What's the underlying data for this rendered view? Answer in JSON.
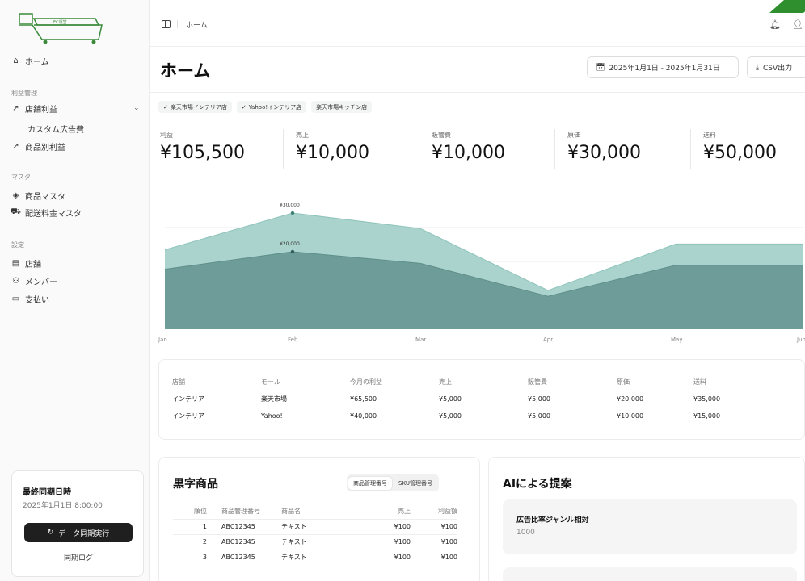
{
  "sidebar": {
    "logo_text": "EC運営",
    "home": "ホーム",
    "section_profit": "利益管理",
    "store_profit": "店舗利益",
    "custom_ad": "カスタム広告費",
    "product_profit": "商品別利益",
    "section_master": "マスタ",
    "product_master": "商品マスタ",
    "shipping_master": "配送料金マスタ",
    "section_settings": "設定",
    "store": "店舗",
    "member": "メンバー",
    "payment": "支払い",
    "sync": {
      "title": "最終同期日時",
      "time": "2025年1月1日 8:00:00",
      "button": "データ同期実行",
      "log": "同期ログ"
    }
  },
  "topbar": {
    "breadcrumb": "ホーム"
  },
  "page": {
    "title": "ホーム",
    "date_range": "2025年1月1日 - 2025年1月31日",
    "csv": "CSV出力"
  },
  "filters": [
    "楽天市場インテリア店",
    "Yahoo!インテリア店",
    "楽天市場キッチン店"
  ],
  "kpis": [
    {
      "label": "利益",
      "value": "¥105,500"
    },
    {
      "label": "売上",
      "value": "¥10,000"
    },
    {
      "label": "販管費",
      "value": "¥10,000"
    },
    {
      "label": "原価",
      "value": "¥30,000"
    },
    {
      "label": "送料",
      "value": "¥50,000"
    }
  ],
  "chart_data": {
    "type": "area",
    "categories": [
      "Jan",
      "Feb",
      "Mar",
      "Apr",
      "May",
      "Jun"
    ],
    "series": [
      {
        "values": [
          20500,
          30000,
          26000,
          10000,
          22000,
          22000
        ],
        "color": "#a9d3cc"
      },
      {
        "values": [
          15500,
          20000,
          17000,
          8500,
          16500,
          16500
        ],
        "color": "#6e9c99"
      }
    ],
    "annotations": [
      "¥30,000",
      "¥20,000"
    ],
    "ylim": [
      0,
      35000
    ]
  },
  "store_table": {
    "headers": [
      "店舗",
      "モール",
      "今月の利益",
      "売上",
      "販管費",
      "原価",
      "送料"
    ],
    "rows": [
      [
        "インテリア",
        "楽天市場",
        "¥65,500",
        "¥5,000",
        "¥5,000",
        "¥20,000",
        "¥35,000"
      ],
      [
        "インテリア",
        "Yahoo!",
        "¥40,000",
        "¥5,000",
        "¥5,000",
        "¥10,000",
        "¥15,000"
      ]
    ]
  },
  "profitable": {
    "title": "黒字商品",
    "toggle": [
      "商品管理番号",
      "SKU管理番号"
    ],
    "headers": [
      "順位",
      "商品管理番号",
      "商品名",
      "売上",
      "利益額"
    ],
    "rows": [
      [
        "1",
        "ABC12345",
        "テキスト",
        "¥100",
        "¥100"
      ],
      [
        "2",
        "ABC12345",
        "テキスト",
        "¥100",
        "¥100"
      ],
      [
        "3",
        "ABC12345",
        "テキスト",
        "¥100",
        "¥100"
      ]
    ]
  },
  "ai": {
    "title": "AIによる提案",
    "item_title": "広告比率ジャンル相対",
    "item_value": "1000"
  }
}
